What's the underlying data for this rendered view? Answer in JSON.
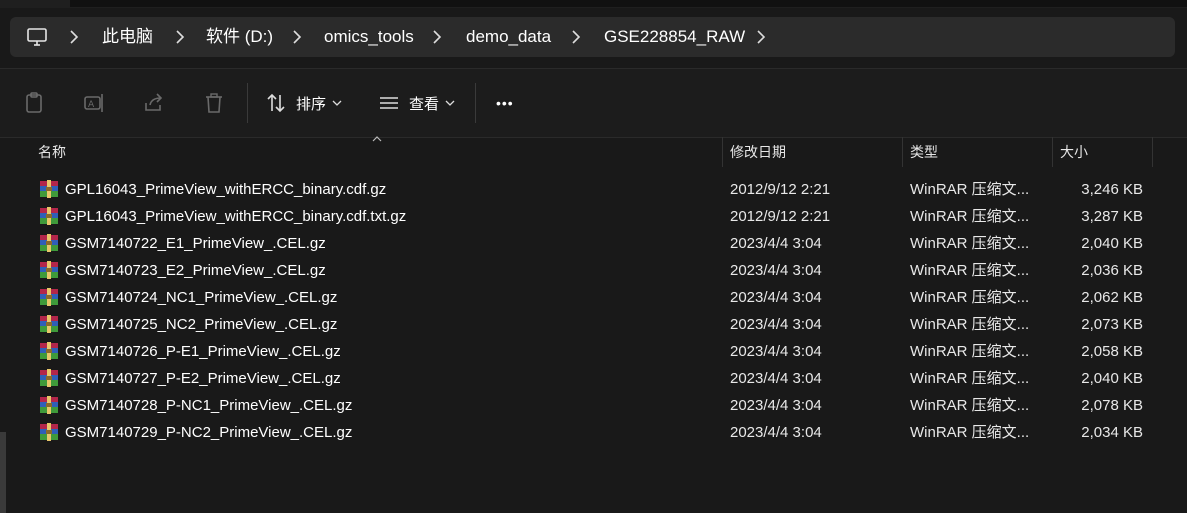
{
  "breadcrumb": {
    "items": [
      "此电脑",
      "软件 (D:)",
      "omics_tools",
      "demo_data",
      "GSE228854_RAW"
    ]
  },
  "toolbar": {
    "sort_label": "排序",
    "view_label": "查看",
    "more_label": "•••"
  },
  "columns": {
    "name": "名称",
    "modified": "修改日期",
    "type": "类型",
    "size": "大小"
  },
  "files": [
    {
      "name": "GPL16043_PrimeView_withERCC_binary.cdf.gz",
      "modified": "2012/9/12 2:21",
      "type": "WinRAR 压缩文...",
      "size": "3,246 KB"
    },
    {
      "name": "GPL16043_PrimeView_withERCC_binary.cdf.txt.gz",
      "modified": "2012/9/12 2:21",
      "type": "WinRAR 压缩文...",
      "size": "3,287 KB"
    },
    {
      "name": "GSM7140722_E1_PrimeView_.CEL.gz",
      "modified": "2023/4/4 3:04",
      "type": "WinRAR 压缩文...",
      "size": "2,040 KB"
    },
    {
      "name": "GSM7140723_E2_PrimeView_.CEL.gz",
      "modified": "2023/4/4 3:04",
      "type": "WinRAR 压缩文...",
      "size": "2,036 KB"
    },
    {
      "name": "GSM7140724_NC1_PrimeView_.CEL.gz",
      "modified": "2023/4/4 3:04",
      "type": "WinRAR 压缩文...",
      "size": "2,062 KB"
    },
    {
      "name": "GSM7140725_NC2_PrimeView_.CEL.gz",
      "modified": "2023/4/4 3:04",
      "type": "WinRAR 压缩文...",
      "size": "2,073 KB"
    },
    {
      "name": "GSM7140726_P-E1_PrimeView_.CEL.gz",
      "modified": "2023/4/4 3:04",
      "type": "WinRAR 压缩文...",
      "size": "2,058 KB"
    },
    {
      "name": "GSM7140727_P-E2_PrimeView_.CEL.gz",
      "modified": "2023/4/4 3:04",
      "type": "WinRAR 压缩文...",
      "size": "2,040 KB"
    },
    {
      "name": "GSM7140728_P-NC1_PrimeView_.CEL.gz",
      "modified": "2023/4/4 3:04",
      "type": "WinRAR 压缩文...",
      "size": "2,078 KB"
    },
    {
      "name": "GSM7140729_P-NC2_PrimeView_.CEL.gz",
      "modified": "2023/4/4 3:04",
      "type": "WinRAR 压缩文...",
      "size": "2,034 KB"
    }
  ],
  "icons": {
    "computer": "computer-icon",
    "chevron": "chevron-right-icon",
    "paste": "clipboard-icon",
    "rename": "rename-icon",
    "share": "share-icon",
    "delete": "trash-icon",
    "sort": "sort-icon",
    "view": "view-list-icon",
    "file": "winrar-archive-icon"
  },
  "colors": {
    "background": "#191919",
    "address_bar": "#2b2b2b",
    "text": "#ffffff",
    "disabled_icon": "#6a6a6a"
  }
}
